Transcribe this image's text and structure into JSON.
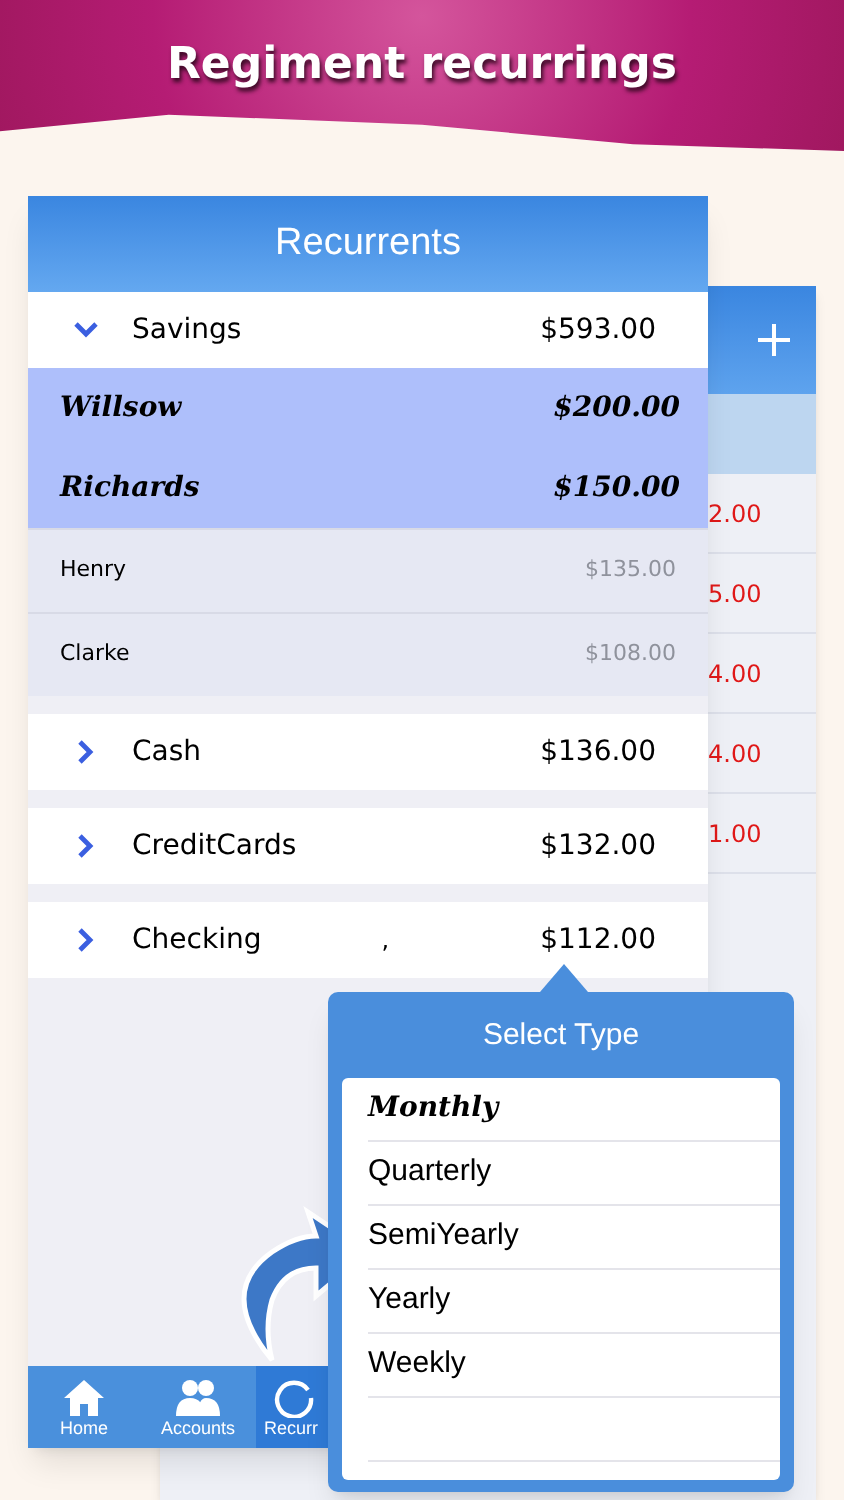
{
  "banner": {
    "title": "Regiment recurrings"
  },
  "back_card": {
    "amounts": [
      "2.00",
      "5.00",
      "4.00",
      "4.00",
      "1.00"
    ]
  },
  "screen": {
    "title": "Recurrents",
    "groups": [
      {
        "name": "Savings",
        "amount": "$593.00",
        "expanded": true,
        "children": [
          {
            "name": "Willsow",
            "amount": "$200.00",
            "selected": true
          },
          {
            "name": "Richards",
            "amount": "$150.00",
            "selected": true
          },
          {
            "name": "Henry",
            "amount": "$135.00",
            "selected": false
          },
          {
            "name": "Clarke",
            "amount": "$108.00",
            "selected": false
          }
        ]
      },
      {
        "name": "Cash",
        "amount": "$136.00",
        "expanded": false
      },
      {
        "name": "CreditCards",
        "amount": "$132.00",
        "expanded": false
      },
      {
        "name": "Checking",
        "amount": "$112.00",
        "expanded": false,
        "mark": ","
      }
    ],
    "tabs": [
      {
        "label": "Home",
        "selected": false
      },
      {
        "label": "Accounts",
        "selected": false
      },
      {
        "label": "Recurr",
        "selected": true
      }
    ]
  },
  "popover": {
    "title": "Select Type",
    "options": [
      {
        "label": "Monthly",
        "selected": true
      },
      {
        "label": "Quarterly",
        "selected": false
      },
      {
        "label": "SemiYearly",
        "selected": false
      },
      {
        "label": "Yearly",
        "selected": false
      },
      {
        "label": "Weekly",
        "selected": false
      }
    ]
  }
}
